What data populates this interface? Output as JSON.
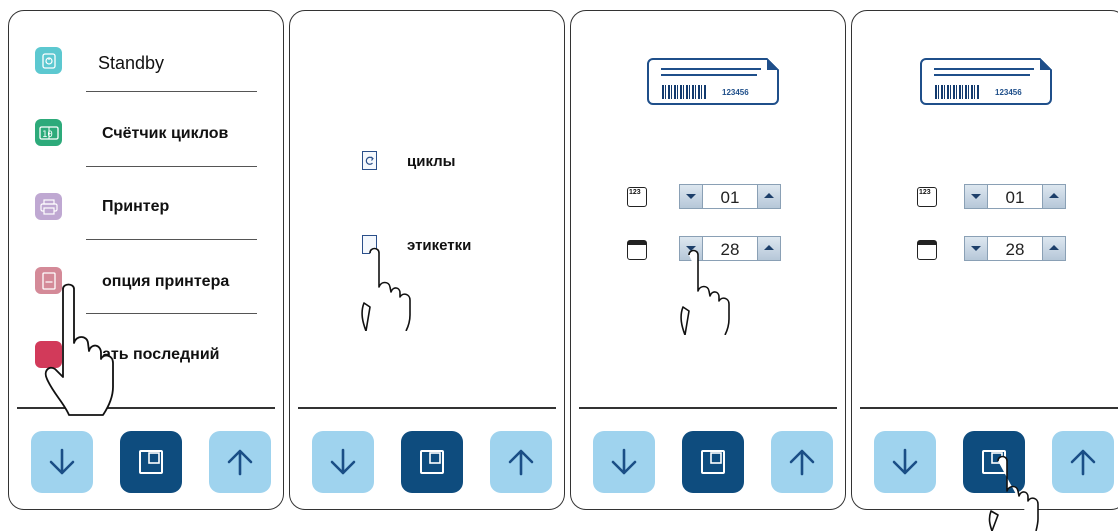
{
  "panel1": {
    "menu": [
      {
        "label": "Standby",
        "icon": "power-icon",
        "color": "#5cc8d0"
      },
      {
        "label": "Счётчик циклов",
        "icon": "counter-icon",
        "color": "#2daa7a"
      },
      {
        "label": "Принтер",
        "icon": "printer-icon",
        "color": "#bfa8d2"
      },
      {
        "label": "опция принтера",
        "icon": "printer-option-icon",
        "color": "#d48a98"
      },
      {
        "label": "ать последний",
        "icon": "print-last-icon",
        "color": "#d23a5a"
      }
    ]
  },
  "panel2": {
    "options": [
      {
        "label": "циклы",
        "icon": "cycle-icon"
      },
      {
        "label": "этикетки",
        "icon": "label-icon"
      }
    ]
  },
  "label_preview": {
    "code": "123456"
  },
  "fields": {
    "count": {
      "value": "01",
      "icon": "numeric-icon"
    },
    "date": {
      "value": "28",
      "icon": "calendar-icon"
    }
  },
  "numeric_icon_text": "123",
  "colors": {
    "button_light": "#9fd3ee",
    "button_dark": "#0e4c7e",
    "accent": "#1f4f8a"
  }
}
